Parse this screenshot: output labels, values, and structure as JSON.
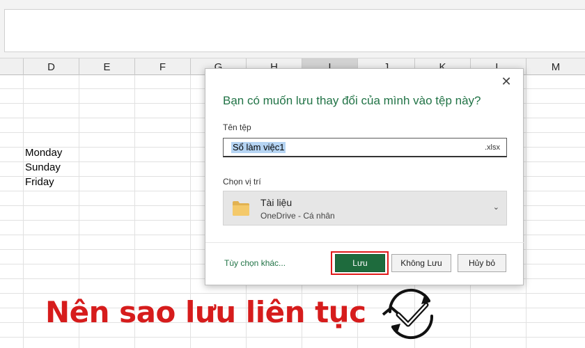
{
  "columns": [
    "D",
    "E",
    "F",
    "G",
    "H",
    "I",
    "J",
    "K",
    "L",
    "M"
  ],
  "cells": [
    "Monday",
    "Sunday",
    "Friday"
  ],
  "dialog": {
    "title": "Bạn có muốn lưu thay đổi của mình vào tệp này?",
    "close_glyph": "✕",
    "file_name_label": "Tên tệp",
    "file_name_value": "Sổ làm việc1",
    "file_extension": ".xlsx",
    "location_label": "Chọn vị trí",
    "location_name": "Tài liệu",
    "location_sub": "OneDrive - Cá nhân",
    "location_chevron": "⌄",
    "more_options": "Tùy chọn khác...",
    "save_label": "Lưu",
    "dont_save_label": "Không Lưu",
    "cancel_label": "Hủy bỏ",
    "accent_color": "#217346",
    "highlight_color": "#e01a1a"
  },
  "caption": {
    "text": "Nên sao lưu liên tục",
    "color": "#d61c1c",
    "icon": "sync-check-icon"
  }
}
